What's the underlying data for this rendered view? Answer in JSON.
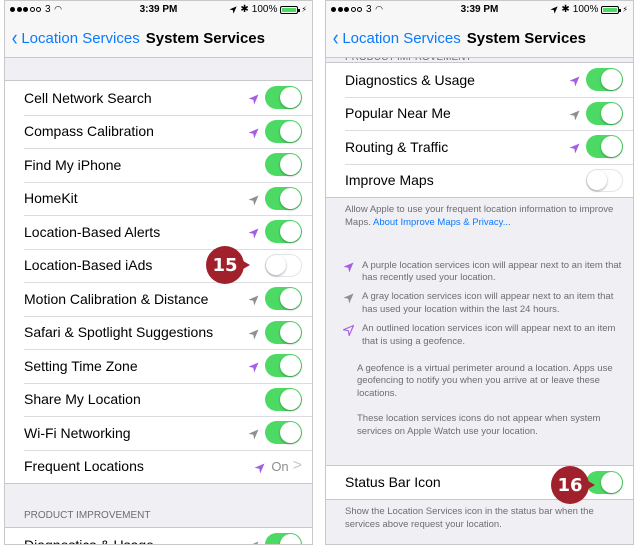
{
  "status_bar": {
    "carrier": "3",
    "time": "3:39 PM",
    "battery": "100%"
  },
  "left": {
    "nav": {
      "back_label": "Location Services",
      "title": "System Services"
    },
    "rows": [
      {
        "label": "Cell Network Search",
        "arrow": "purple",
        "toggle": "on"
      },
      {
        "label": "Compass Calibration",
        "arrow": "purple",
        "toggle": "on"
      },
      {
        "label": "Find My iPhone",
        "arrow": "",
        "toggle": "on"
      },
      {
        "label": "HomeKit",
        "arrow": "gray",
        "toggle": "on"
      },
      {
        "label": "Location-Based Alerts",
        "arrow": "purple",
        "toggle": "on"
      },
      {
        "label": "Location-Based iAds",
        "arrow": "",
        "toggle": "off"
      },
      {
        "label": "Motion Calibration & Distance",
        "arrow": "gray",
        "toggle": "on"
      },
      {
        "label": "Safari & Spotlight Suggestions",
        "arrow": "gray",
        "toggle": "on"
      },
      {
        "label": "Setting Time Zone",
        "arrow": "purple",
        "toggle": "on"
      },
      {
        "label": "Share My Location",
        "arrow": "",
        "toggle": "on"
      },
      {
        "label": "Wi-Fi Networking",
        "arrow": "gray",
        "toggle": "on"
      },
      {
        "label": "Frequent Locations",
        "arrow": "purple",
        "detail": "On",
        "disclosure": ">"
      }
    ],
    "section_header": "PRODUCT IMPROVEMENT",
    "partial_row": {
      "label": "Diagnostics & Usage",
      "arrow": "gray",
      "toggle": "on"
    },
    "callout": "15"
  },
  "right": {
    "nav": {
      "back_label": "Location Services",
      "title": "System Services"
    },
    "section_header_partial": "PRODUCT IMPROVEMENT",
    "rows": [
      {
        "label": "Diagnostics & Usage",
        "arrow": "purple",
        "toggle": "on"
      },
      {
        "label": "Popular Near Me",
        "arrow": "gray",
        "toggle": "on"
      },
      {
        "label": "Routing & Traffic",
        "arrow": "purple",
        "toggle": "on"
      },
      {
        "label": "Improve Maps",
        "arrow": "",
        "toggle": "off"
      }
    ],
    "footer": {
      "text": "Allow Apple to use your frequent location information to improve Maps.",
      "link": "About Improve Maps & Privacy..."
    },
    "legend": [
      {
        "icon": "purple",
        "text": "A purple location services icon will appear next to an item that has recently used your location."
      },
      {
        "icon": "gray",
        "text": "A gray location services icon will appear next to an item that has used your location within the last 24 hours."
      },
      {
        "icon": "outline",
        "text": "An outlined location services icon will appear next to an item that is using a geofence."
      }
    ],
    "para1": "A geofence is a virtual perimeter around a location. Apps use geofencing to notify you when you arrive at or leave these locations.",
    "para2": "These location services icons do not appear when system services on Apple Watch use your location.",
    "status_bar_row": {
      "label": "Status Bar Icon",
      "toggle": "on"
    },
    "status_bar_footer": "Show the Location Services icon in the status bar when the services above request your location.",
    "callout": "16"
  },
  "colors": {
    "purple": "#a45ee5",
    "gray": "#8e8e93",
    "green": "#4cd964",
    "link": "#0a7aff",
    "callout": "#a0212c"
  }
}
